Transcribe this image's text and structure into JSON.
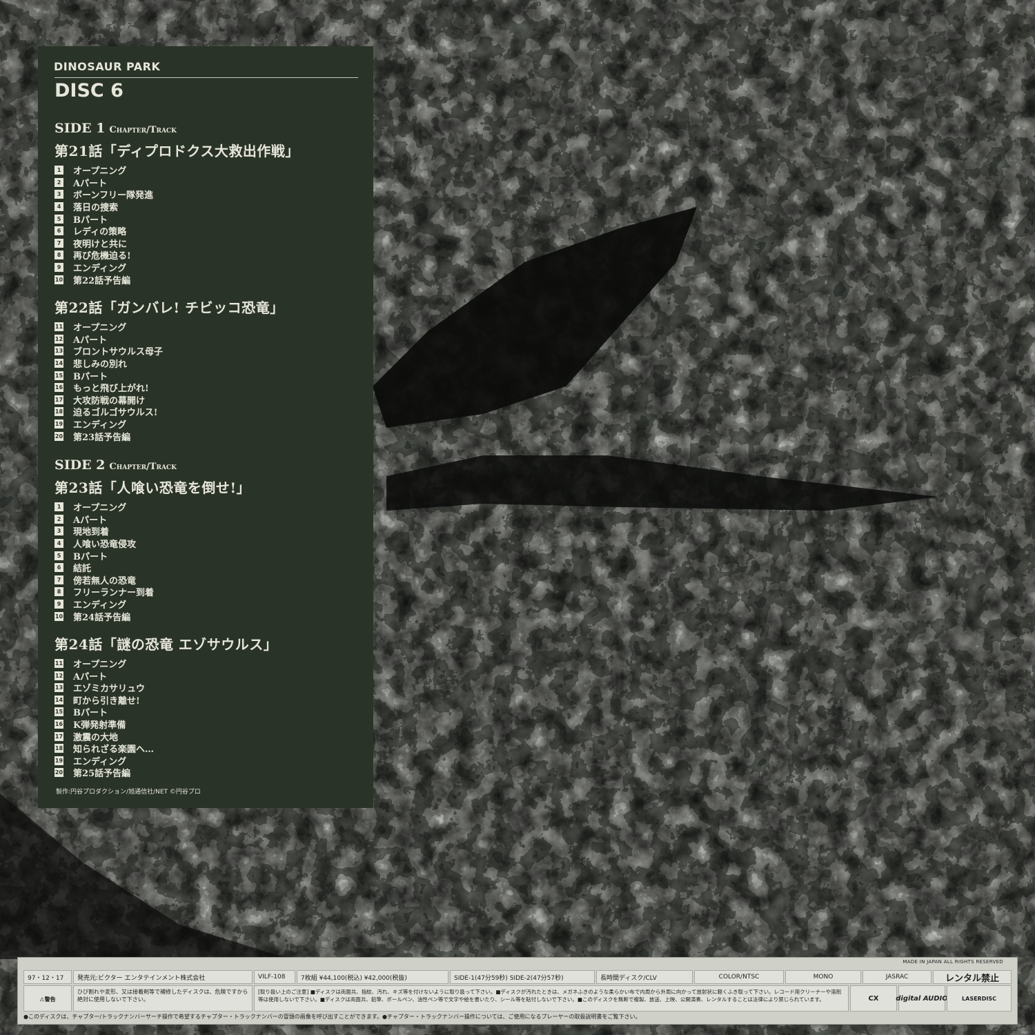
{
  "panel": {
    "brand": "DINOSAUR PARK",
    "disc": "DISC 6",
    "side1": {
      "label": "SIDE 1",
      "sub": "Chapter/Track"
    },
    "side2": {
      "label": "SIDE 2",
      "sub": "Chapter/Track"
    },
    "episodes": [
      {
        "title": "第21話「ディプロドクス大救出作戦」",
        "tracks": [
          {
            "n": "1",
            "t": "オープニング"
          },
          {
            "n": "2",
            "t": "Aパート"
          },
          {
            "n": "3",
            "t": "ボーンフリー隊発進"
          },
          {
            "n": "4",
            "t": "落日の捜索"
          },
          {
            "n": "5",
            "t": "Bパート"
          },
          {
            "n": "6",
            "t": "レディの策略"
          },
          {
            "n": "7",
            "t": "夜明けと共に"
          },
          {
            "n": "8",
            "t": "再び危機迫る!"
          },
          {
            "n": "9",
            "t": "エンディング"
          },
          {
            "n": "10",
            "t": "第22話予告編"
          }
        ]
      },
      {
        "title": "第22話「ガンバレ! チビッコ恐竜」",
        "tracks": [
          {
            "n": "11",
            "t": "オープニング"
          },
          {
            "n": "12",
            "t": "Aパート"
          },
          {
            "n": "13",
            "t": "ブロントサウルス母子"
          },
          {
            "n": "14",
            "t": "悲しみの別れ"
          },
          {
            "n": "15",
            "t": "Bパート"
          },
          {
            "n": "16",
            "t": "もっと飛び上がれ!"
          },
          {
            "n": "17",
            "t": "大攻防戦の幕開け"
          },
          {
            "n": "18",
            "t": "迫るゴルゴサウルス!"
          },
          {
            "n": "19",
            "t": "エンディング"
          },
          {
            "n": "20",
            "t": "第23話予告編"
          }
        ]
      },
      {
        "title": "第23話「人喰い恐竜を倒せ!」",
        "tracks": [
          {
            "n": "1",
            "t": "オープニング"
          },
          {
            "n": "2",
            "t": "Aパート"
          },
          {
            "n": "3",
            "t": "現地到着"
          },
          {
            "n": "4",
            "t": "人喰い恐竜侵攻"
          },
          {
            "n": "5",
            "t": "Bパート"
          },
          {
            "n": "6",
            "t": "結託"
          },
          {
            "n": "7",
            "t": "傍若無人の恐竜"
          },
          {
            "n": "8",
            "t": "フリーランナー到着"
          },
          {
            "n": "9",
            "t": "エンディング"
          },
          {
            "n": "10",
            "t": "第24話予告編"
          }
        ]
      },
      {
        "title": "第24話「謎の恐竜 エゾサウルス」",
        "tracks": [
          {
            "n": "11",
            "t": "オープニング"
          },
          {
            "n": "12",
            "t": "Aパート"
          },
          {
            "n": "13",
            "t": "エゾミカサリュウ"
          },
          {
            "n": "14",
            "t": "町から引き離せ!"
          },
          {
            "n": "15",
            "t": "Bパート"
          },
          {
            "n": "16",
            "t": "K弾発射準備"
          },
          {
            "n": "17",
            "t": "激震の大地"
          },
          {
            "n": "18",
            "t": "知られざる楽園へ…"
          },
          {
            "n": "19",
            "t": "エンディング"
          },
          {
            "n": "20",
            "t": "第25話予告編"
          }
        ]
      }
    ],
    "credit": "製作:円谷プロダクション/旭通信社/NET ©円谷プロ"
  },
  "strip": {
    "made_in": "MADE IN JAPAN  ALL RIGHTS RESERVED",
    "date": "97・12・17",
    "publisher": "発売元:ビクター エンタテインメント株式会社",
    "catalog": "VILF-108",
    "price": "7枚組 ¥44,100(税込) ¥42,000(税抜)",
    "duration": "SIDE-1(47分59秒) SIDE-2(47分57秒)",
    "disc_type": "長時間ディスク/CLV",
    "color": "COLOR/NTSC",
    "audio": "MONO",
    "jasrac": "JASRAC",
    "rental": "レンタル禁止",
    "warning": "⚠警告",
    "warning_text": "ひび割れや変形、又は接着剤等で補修したディスクは、危険ですから絶対に使用しないで下さい。",
    "care_text": "[取り扱い上のご注意] ■ディスクは両面共、指紋、汚れ、キズ等を付けないように取り扱って下さい。■ディスクが汚れたときは、メガネふきのような柔らかい布で内周から外周に向かって放射状に軽くふき取って下さい。レコード用クリーナーや溶剤等は使用しないで下さい。■ディスクは両面共、鉛筆、ボールペン、油性ペン等で文字や絵を書いたり、シール等を貼付しないで下さい。■このディスクを無断で複製、放送、上映、公開演奏、レンタルすることは法律により禁じられています。",
    "logos": [
      "CX",
      "digital AUDIO",
      "LASERDISC"
    ],
    "footnote": "●このディスクは、チャプター/トラックナンバーサーチ操作で希望するチャプター・トラックナンバーの冒頭の画像を呼び出すことができます。●チャプター・トラックナンバー操作については、ご使用になるプレーヤーの取扱説明書をご覧下さい。"
  }
}
